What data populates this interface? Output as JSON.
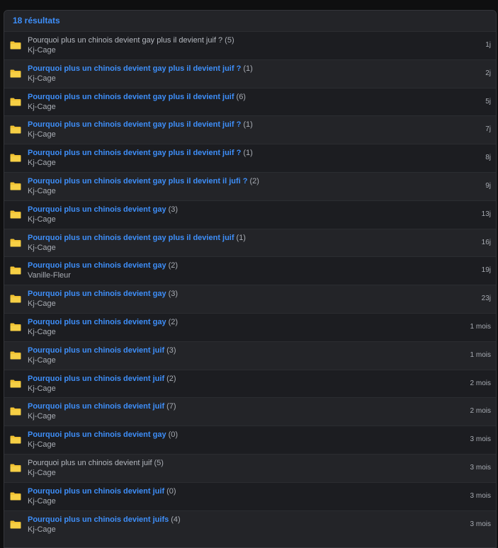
{
  "results_header": "18 résultats",
  "colors": {
    "link": "#3e8ffa",
    "folder": "#f1c232",
    "muted": "#a8acb3"
  },
  "topics": [
    {
      "title": "Pourquoi plus un chinois devient gay plus il devient juif ?",
      "count": "(5)",
      "author": "Kj-Cage",
      "time": "1j",
      "visited": true
    },
    {
      "title": "Pourquoi plus un chinois devient gay plus il devient juif ?",
      "count": "(1)",
      "author": "Kj-Cage",
      "time": "2j",
      "visited": false
    },
    {
      "title": "Pourquoi plus un chinois devient gay plus il devient juif",
      "count": "(6)",
      "author": "Kj-Cage",
      "time": "5j",
      "visited": false
    },
    {
      "title": "Pourquoi plus un chinois devient gay plus il devient juif ?",
      "count": "(1)",
      "author": "Kj-Cage",
      "time": "7j",
      "visited": false
    },
    {
      "title": "Pourquoi plus un chinois devient gay plus il devient juif ?",
      "count": "(1)",
      "author": "Kj-Cage",
      "time": "8j",
      "visited": false
    },
    {
      "title": "Pourquoi plus un chinois devient gay plus il devient il jufi ?",
      "count": "(2)",
      "author": "Kj-Cage",
      "time": "9j",
      "visited": false
    },
    {
      "title": "Pourquoi plus un chinois devient gay",
      "count": "(3)",
      "author": "Kj-Cage",
      "time": "13j",
      "visited": false
    },
    {
      "title": "Pourquoi plus un chinois devient gay plus il devient juif",
      "count": "(1)",
      "author": "Kj-Cage",
      "time": "16j",
      "visited": false
    },
    {
      "title": "Pourquoi plus un chinois devient gay",
      "count": "(2)",
      "author": "Vanille-Fleur",
      "time": "19j",
      "visited": false
    },
    {
      "title": "Pourquoi plus un chinois devient gay",
      "count": "(3)",
      "author": "Kj-Cage",
      "time": "23j",
      "visited": false
    },
    {
      "title": "Pourquoi plus un chinois devient gay",
      "count": "(2)",
      "author": "Kj-Cage",
      "time": "1 mois",
      "visited": false
    },
    {
      "title": "Pourquoi plus un chinois devient juif",
      "count": "(3)",
      "author": "Kj-Cage",
      "time": "1 mois",
      "visited": false
    },
    {
      "title": "Pourquoi plus un chinois devient juif",
      "count": "(2)",
      "author": "Kj-Cage",
      "time": "2 mois",
      "visited": false
    },
    {
      "title": "Pourquoi plus un chinois devient juif",
      "count": "(7)",
      "author": "Kj-Cage",
      "time": "2 mois",
      "visited": false
    },
    {
      "title": "Pourquoi plus un chinois devient gay",
      "count": "(0)",
      "author": "Kj-Cage",
      "time": "3 mois",
      "visited": false
    },
    {
      "title": "Pourquoi plus un chinois devient juif",
      "count": "(5)",
      "author": "Kj-Cage",
      "time": "3 mois",
      "visited": true
    },
    {
      "title": "Pourquoi plus un chinois devient juif",
      "count": "(0)",
      "author": "Kj-Cage",
      "time": "3 mois",
      "visited": false
    },
    {
      "title": "Pourquoi plus un chinois devient juifs",
      "count": "(4)",
      "author": "Kj-Cage",
      "time": "3 mois",
      "visited": false
    }
  ]
}
